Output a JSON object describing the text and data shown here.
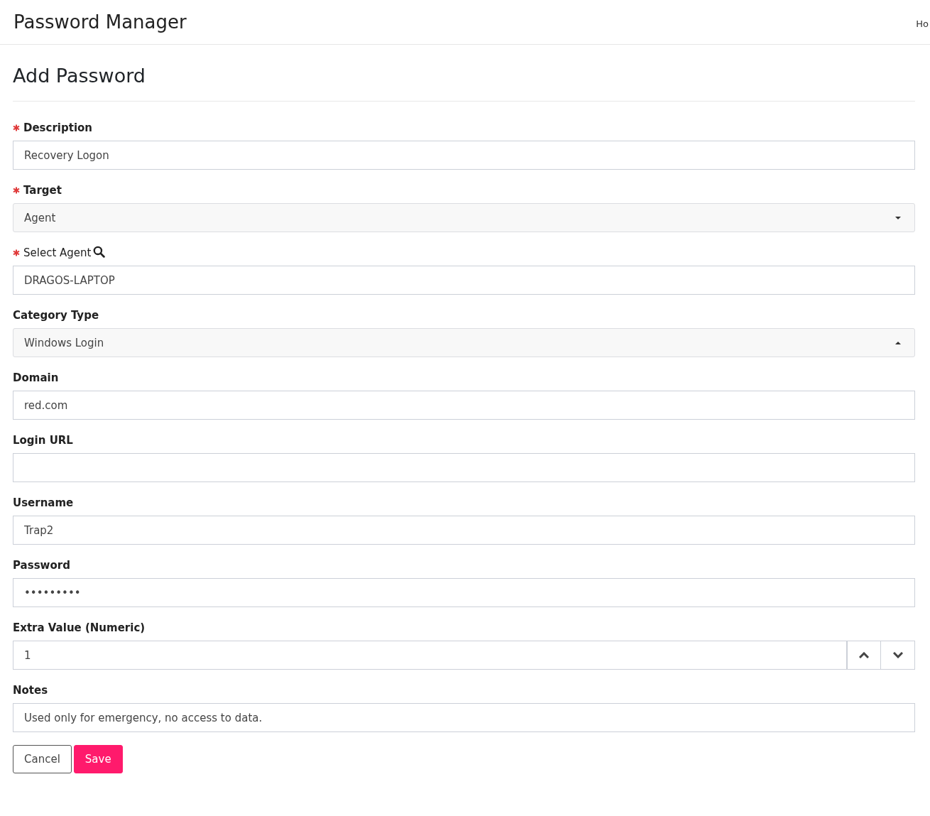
{
  "navbar": {
    "brand": "Password Manager",
    "link": "Ho"
  },
  "page": {
    "title": "Add Password"
  },
  "fields": [
    {
      "kind": "text",
      "label": "Description",
      "required": true,
      "value": "Recovery Logon"
    },
    {
      "kind": "select",
      "label": "Target",
      "required": true,
      "value": "Agent",
      "expanded": false
    },
    {
      "kind": "search",
      "label": "Select Agent",
      "required": true,
      "value": "DRAGOS-LAPTOP"
    },
    {
      "kind": "select",
      "label": "Category Type",
      "required": false,
      "value": "Windows Login",
      "expanded": true
    },
    {
      "kind": "text",
      "label": "Domain",
      "required": false,
      "value": "red.com"
    },
    {
      "kind": "text",
      "label": "Login URL",
      "required": false
    },
    {
      "kind": "text",
      "label": "Username",
      "required": false,
      "value": "Trap2"
    },
    {
      "kind": "text",
      "label": "Password",
      "required": false,
      "value": "•••••••••"
    },
    {
      "kind": "number",
      "label": "Extra Value (Numeric)",
      "required": false,
      "value": "1"
    },
    {
      "kind": "text",
      "label": "Notes",
      "required": false,
      "value": "Used only for emergency, no access to data."
    }
  ],
  "buttons": [
    {
      "kind": "secondary",
      "label": "Cancel"
    },
    {
      "kind": "primary",
      "label": "Save"
    }
  ]
}
